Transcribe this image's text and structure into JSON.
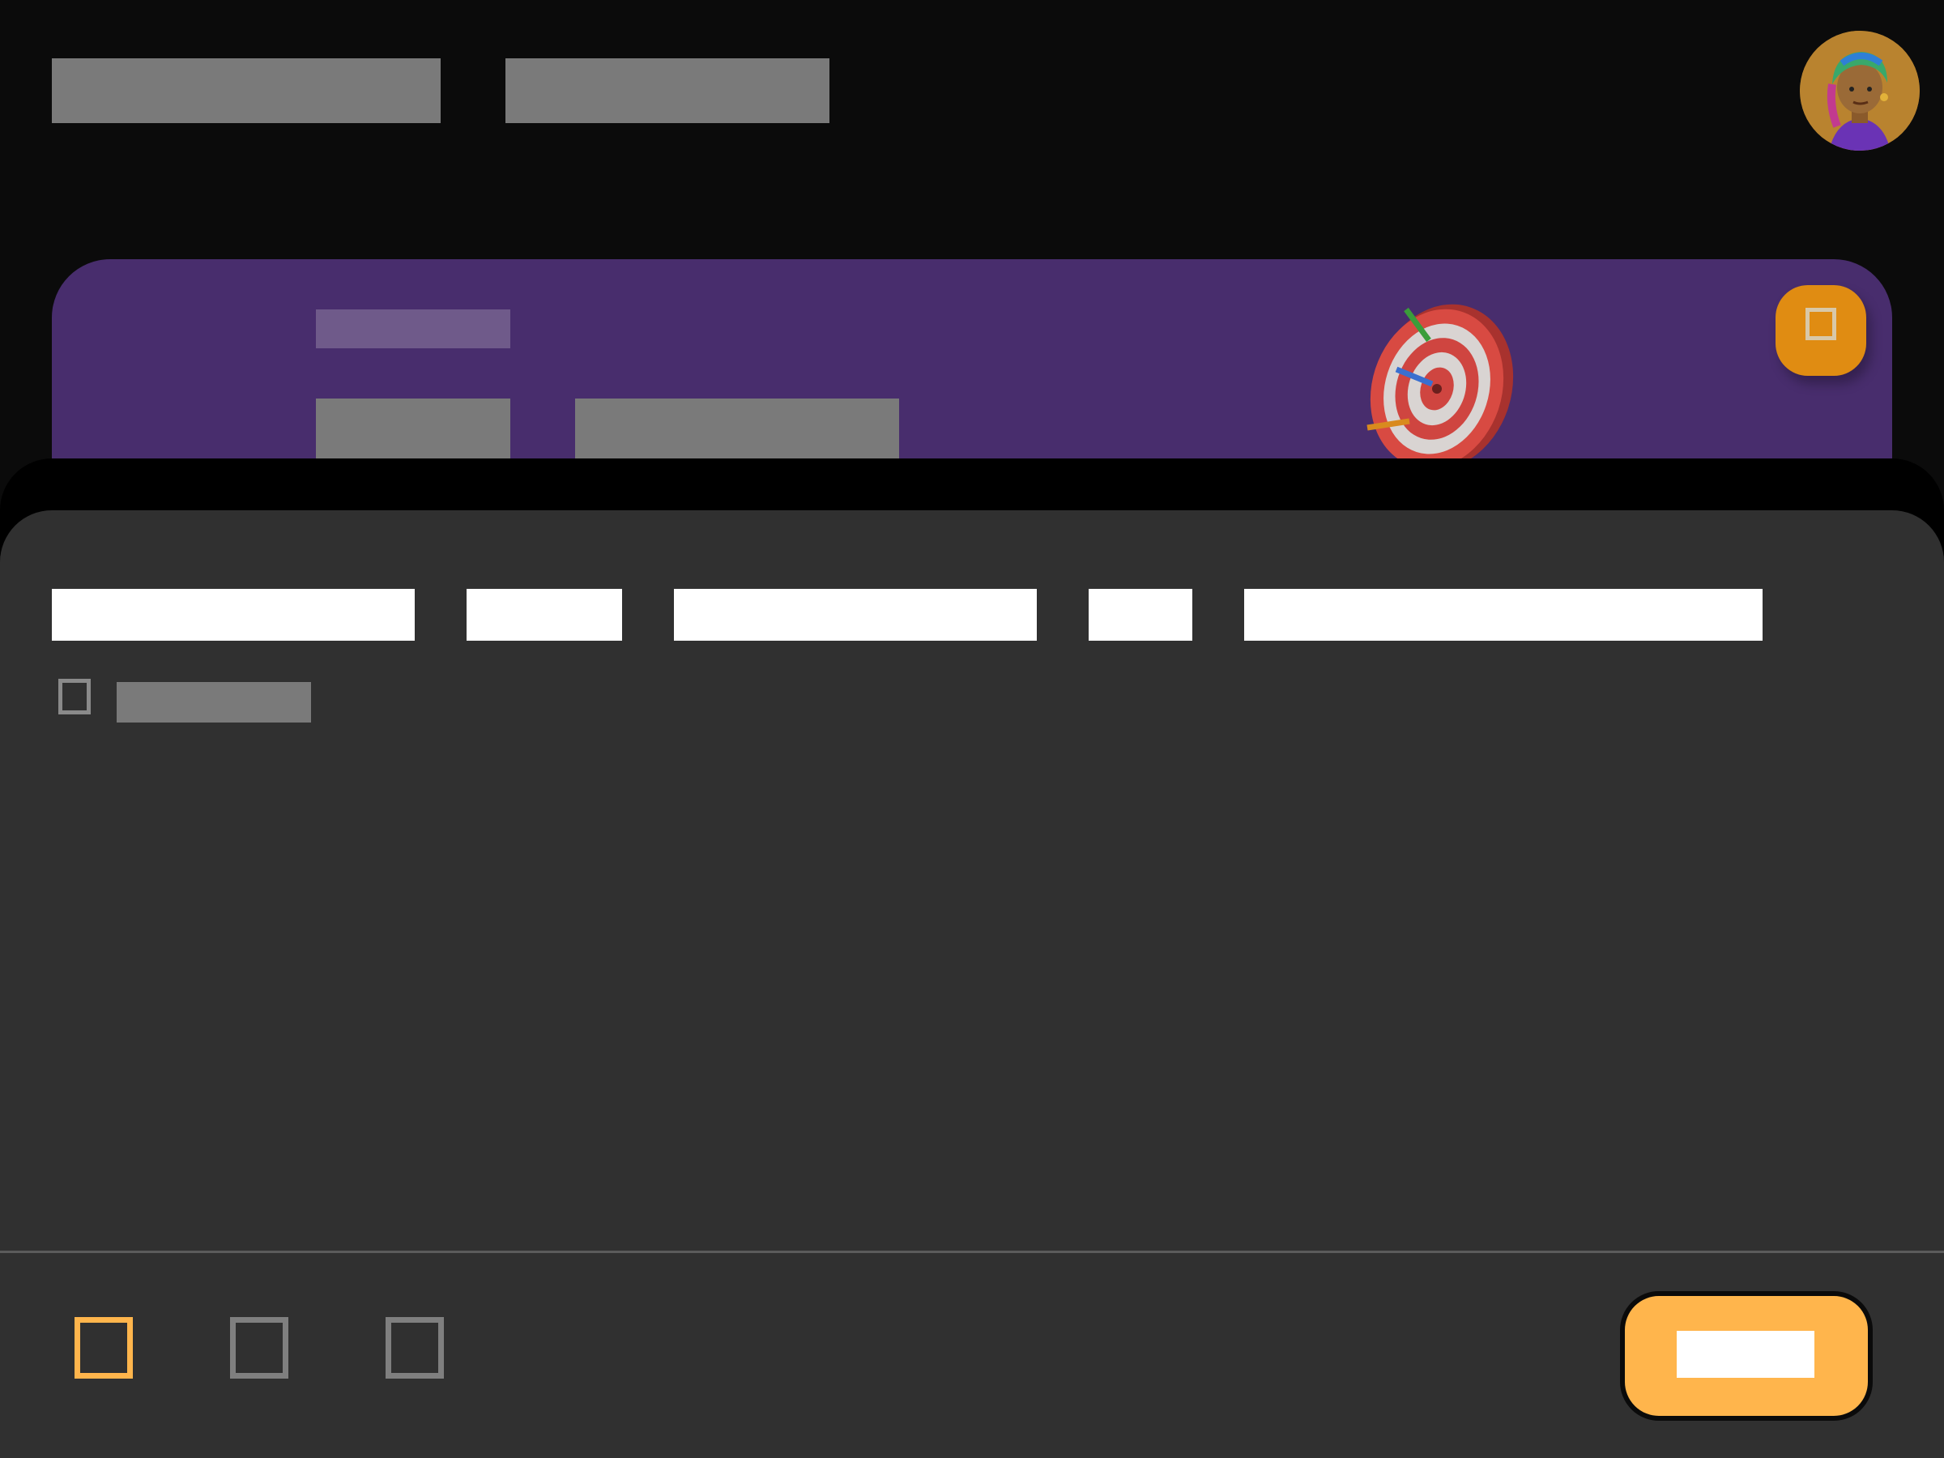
{
  "header": {
    "title_primary": "",
    "title_secondary": "",
    "avatar_icon": "user-avatar"
  },
  "hero": {
    "background": "#482d6d",
    "label": "",
    "line_left": "",
    "line_right": "",
    "illustration_icon": "dartboard-target-icon",
    "action_icon": "square-icon",
    "action_color": "#e08c12"
  },
  "sheet": {
    "tabs": [
      {
        "label": ""
      },
      {
        "label": ""
      },
      {
        "label": ""
      },
      {
        "label": ""
      },
      {
        "label": ""
      }
    ],
    "checkbox": {
      "label": "",
      "checked": false
    }
  },
  "bottom_nav": {
    "items": [
      {
        "icon": "square-icon",
        "active": true
      },
      {
        "icon": "square-icon",
        "active": false
      },
      {
        "icon": "square-icon",
        "active": false
      }
    ],
    "accent": "#ffb54c",
    "cta_label": ""
  }
}
